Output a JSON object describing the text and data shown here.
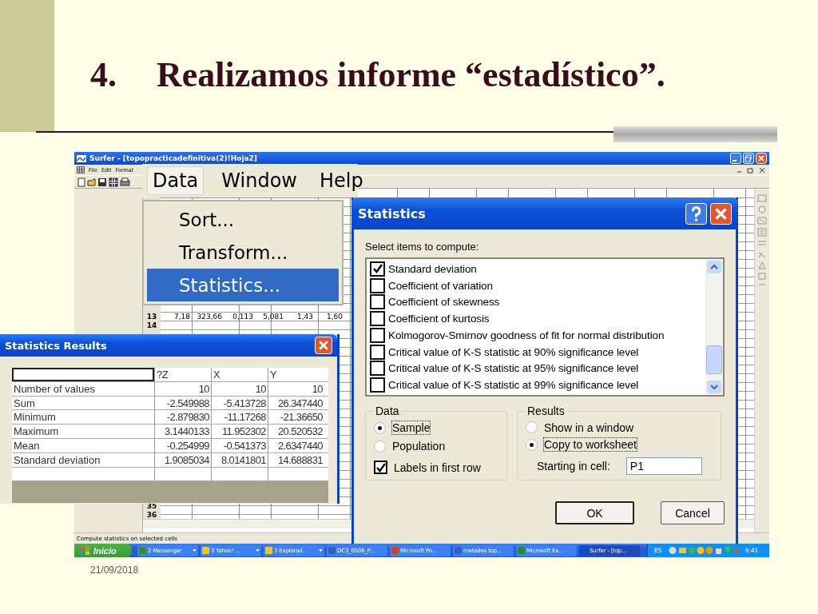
{
  "slide": {
    "number": "4.",
    "title": "Realizamos informe “estadístico”.",
    "date": "21/09/2018"
  },
  "app": {
    "title": "Surfer - [topopracticadefinitiva(2)!Hoja2]",
    "menu": [
      "File",
      "Edit",
      "Format"
    ],
    "rows_upper": [
      {
        "header": "13",
        "cells": [
          "7,18",
          "323,66",
          "0,113",
          "5,081",
          "1,43",
          "1,60"
        ]
      },
      {
        "header": "14"
      }
    ],
    "rows_lower": [
      {
        "header": "35"
      },
      {
        "header": "36"
      }
    ],
    "status_bar": "Compute statistics on selected cells"
  },
  "data_menu": {
    "menus": [
      {
        "label": "Data",
        "selected": true
      },
      {
        "label": "Window",
        "selected": false
      },
      {
        "label": "Help",
        "selected": false
      }
    ],
    "items": [
      {
        "label": "Sort...",
        "selected": false
      },
      {
        "label": "Transform...",
        "selected": false
      },
      {
        "label": "Statistics...",
        "selected": true
      }
    ]
  },
  "statistics_dialog": {
    "title": "Statistics",
    "prompt": "Select items to compute:",
    "items": [
      {
        "label": "Standard deviation",
        "checked": true
      },
      {
        "label": "Coefficient of variation",
        "checked": false
      },
      {
        "label": "Coefficient of skewness",
        "checked": false
      },
      {
        "label": "Coefficient of kurtosis",
        "checked": false
      },
      {
        "label": "Kolmogorov-Smirnov goodness of fit for normal distribution",
        "checked": false
      },
      {
        "label": "Critical value of K-S statistic at 90% significance level",
        "checked": false
      },
      {
        "label": "Critical value of K-S statistic at 95% significance level",
        "checked": false
      },
      {
        "label": "Critical value of K-S statistic at 99% significance level",
        "checked": false
      }
    ],
    "data_group": {
      "title": "Data",
      "options": [
        {
          "label": "Sample",
          "selected": true
        },
        {
          "label": "Population",
          "selected": false
        }
      ],
      "labels_in_first_row": {
        "label": "Labels in first row",
        "checked": true
      }
    },
    "results_group": {
      "title": "Results",
      "options": [
        {
          "label": "Show in a window",
          "selected": false
        },
        {
          "label": "Copy to worksheet",
          "selected": true
        }
      ],
      "start_cell": {
        "label": "Starting in cell:",
        "value": "P1"
      }
    },
    "buttons": [
      "OK",
      "Cancel"
    ]
  },
  "results_window": {
    "title": "Statistics Results",
    "columns": [
      "?Z",
      "X",
      "Y"
    ],
    "rows": [
      {
        "label": "Number of values",
        "values": [
          "10",
          "10",
          "10"
        ]
      },
      {
        "label": "Sum",
        "values": [
          "-2.549988",
          "-5.413728",
          "26.347440"
        ]
      },
      {
        "label": "Minimum",
        "values": [
          "-2.879830",
          "-11.17268",
          "-21.36650"
        ]
      },
      {
        "label": "Maximum",
        "values": [
          "3.1440133",
          "11.952302",
          "20.520532"
        ]
      },
      {
        "label": "Mean",
        "values": [
          "-0.254999",
          "-0.541373",
          "2.6347440"
        ]
      },
      {
        "label": "Standard deviation",
        "values": [
          "1.9085034",
          "8.0141801",
          "14.688831"
        ]
      }
    ]
  },
  "taskbar": {
    "start": "Inicio",
    "tasks": [
      {
        "label": "2 Messenger",
        "grouped": true,
        "selected": false
      },
      {
        "label": "3 Yahoo! ...",
        "grouped": true,
        "selected": false
      },
      {
        "label": "3 Explorad...",
        "grouped": true,
        "selected": false
      },
      {
        "label": "DC3_0506_P...",
        "grouped": false,
        "selected": false
      },
      {
        "label": "Microsoft Po...",
        "grouped": false,
        "selected": false
      },
      {
        "label": "metodos top...",
        "grouped": false,
        "selected": false
      },
      {
        "label": "Microsoft Ex...",
        "grouped": false,
        "selected": false
      },
      {
        "label": "Surfer - [top...",
        "grouped": false,
        "selected": true
      }
    ],
    "language": "ES",
    "clock": "9:41"
  }
}
